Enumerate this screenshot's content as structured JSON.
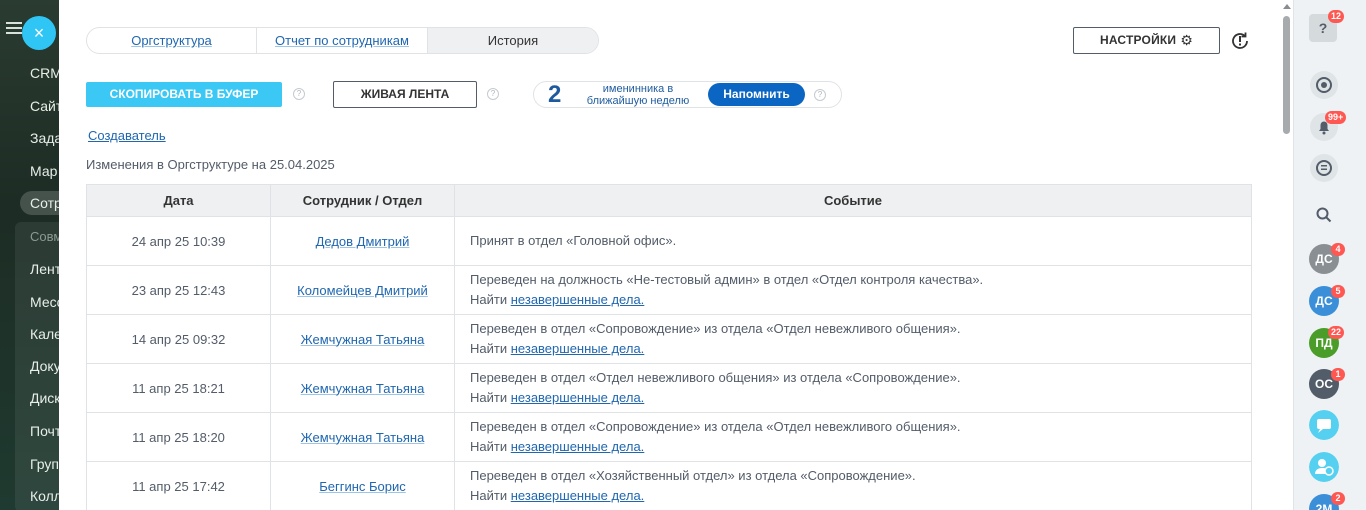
{
  "left_sidebar": {
    "items": [
      "CRM",
      "Сайт",
      "Зада",
      "Мар",
      "Сотр",
      "Совм",
      "Лент",
      "Месс",
      "Кале",
      "Доку",
      "Диск",
      "Почт",
      "Груп",
      "Колл"
    ]
  },
  "close_button": {
    "symbol": "×"
  },
  "tabs": [
    {
      "label": "Оргструктура"
    },
    {
      "label": "Отчет по сотрудникам"
    },
    {
      "label": "История"
    }
  ],
  "settings_button": {
    "label": "НАСТРОЙКИ"
  },
  "toolbar": {
    "copy_label": "СКОПИРОВАТЬ В БУФЕР",
    "live_label": "ЖИВАЯ ЛЕНТА",
    "help_symbol": "?"
  },
  "birthdays": {
    "count": "2",
    "text": "именинника в ближайшую неделю",
    "remind_label": "Напомнить"
  },
  "creator_link": "Создаватель",
  "subtitle": "Изменения в Оргструктуре на 25.04.2025",
  "table": {
    "headers": [
      "Дата",
      "Сотрудник / Отдел",
      "Событие"
    ],
    "rows": [
      {
        "date": "24 апр 25  10:39",
        "employee": "Дедов Дмитрий",
        "event": "Принят в отдел «Головной офис».",
        "find": "",
        "link": ""
      },
      {
        "date": "23 апр 25  12:43",
        "employee": "Коломейцев Дмитрий",
        "event": "Переведен на должность «Не-тестовый админ» в отдел «Отдел контроля качества».",
        "find": "Найти",
        "link": "незавершенные дела."
      },
      {
        "date": "14 апр 25  09:32",
        "employee": "Жемчужная Татьяна",
        "event": "Переведен в отдел «Сопровождение» из отдела «Отдел невежливого общения».",
        "find": "Найти",
        "link": "незавершенные дела."
      },
      {
        "date": "11 апр 25  18:21",
        "employee": "Жемчужная Татьяна",
        "event": "Переведен в отдел «Отдел невежливого общения» из отдела «Сопровождение».",
        "find": "Найти",
        "link": "незавершенные дела."
      },
      {
        "date": "11 апр 25  18:20",
        "employee": "Жемчужная Татьяна",
        "event": "Переведен в отдел «Сопровождение» из отдела «Отдел невежливого общения».",
        "find": "Найти",
        "link": "незавершенные дела."
      },
      {
        "date": "11 апр 25  17:42",
        "employee": "Беггинс Борис",
        "event": "Переведен в отдел «Хозяйственный отдел» из отдела «Сопровождение».",
        "find": "Найти",
        "link": "незавершенные дела."
      }
    ]
  },
  "right_sidebar": {
    "help": {
      "symbol": "?",
      "badge": "12"
    },
    "notifications_badge": "99+",
    "avatars": [
      {
        "initials": "ДС",
        "badge": "4",
        "color": "#8a8f94"
      },
      {
        "initials": "ДС",
        "badge": "5",
        "color": "#3b8fd8"
      },
      {
        "initials": "ПД",
        "badge": "22",
        "color": "#4a9d28"
      },
      {
        "initials": "ОС",
        "badge": "1",
        "color": "#535c69"
      },
      {
        "initials": "2М",
        "badge": "2",
        "color": "#3b8fd8"
      }
    ]
  }
}
